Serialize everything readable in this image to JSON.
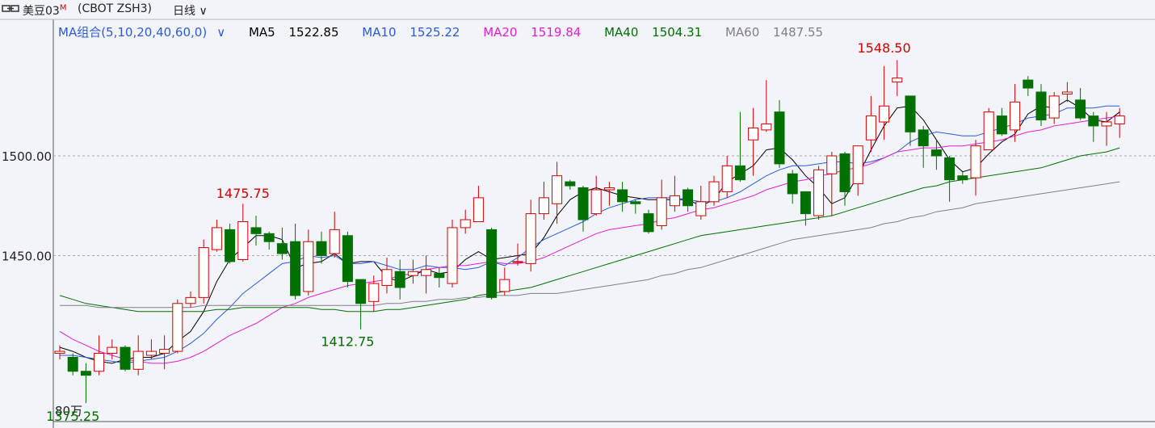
{
  "header": {
    "symbol": "美豆03",
    "symbol_sup": "M",
    "code": "(CBOT ZSH3)",
    "period": "日线"
  },
  "ma_legend": {
    "group": "MA组合(5,10,20,40,60,0)",
    "items": [
      {
        "label": "MA5",
        "value": "1522.85",
        "color": "#000000"
      },
      {
        "label": "MA10",
        "value": "1525.22",
        "color": "#2a5cd8"
      },
      {
        "label": "MA20",
        "value": "1519.84",
        "color": "#e020d0"
      },
      {
        "label": "MA40",
        "value": "1504.31",
        "color": "#007000"
      },
      {
        "label": "MA60",
        "value": "1487.55",
        "color": "#808080"
      }
    ]
  },
  "chart_data": {
    "type": "candlestick",
    "y_ticks": [
      {
        "value": 1500,
        "label": "1500.00"
      },
      {
        "value": 1450,
        "label": "1450.00"
      }
    ],
    "ylim": [
      1370,
      1560
    ],
    "annotations": [
      {
        "index": 14,
        "value": 1475.75,
        "label": "1475.75",
        "position": "above",
        "color": "#d00000"
      },
      {
        "index": 22,
        "value": 1412.75,
        "label": "1412.75",
        "position": "below",
        "color": "#007000"
      },
      {
        "index": 63,
        "value": 1548.5,
        "label": "1548.50",
        "position": "above",
        "color": "#d00000"
      },
      {
        "index": 1,
        "value": 1375.25,
        "label": "1375.25",
        "position": "below",
        "color": "#007000"
      }
    ],
    "bottom_label": "80万",
    "up_color": "#d00000",
    "down_color": "#007000",
    "candles": [
      [
        1401,
        1402,
        1405,
        1398
      ],
      [
        1399,
        1392,
        1401,
        1390
      ],
      [
        1392,
        1390,
        1396,
        1376
      ],
      [
        1392,
        1401,
        1410,
        1390
      ],
      [
        1401,
        1404,
        1408,
        1398
      ],
      [
        1404,
        1393,
        1405,
        1392
      ],
      [
        1393,
        1402,
        1410,
        1390
      ],
      [
        1400,
        1402,
        1408,
        1398
      ],
      [
        1401,
        1403,
        1410,
        1393
      ],
      [
        1402,
        1426,
        1428,
        1401
      ],
      [
        1426,
        1429,
        1432,
        1424
      ],
      [
        1429,
        1454,
        1458,
        1426
      ],
      [
        1453,
        1464,
        1468,
        1452
      ],
      [
        1463,
        1447,
        1466,
        1446
      ],
      [
        1448,
        1467,
        1476,
        1447
      ],
      [
        1464,
        1461,
        1470,
        1455
      ],
      [
        1461,
        1457,
        1462,
        1453
      ],
      [
        1456,
        1451,
        1464,
        1448
      ],
      [
        1457,
        1430,
        1466,
        1428
      ],
      [
        1432,
        1457,
        1463,
        1430
      ],
      [
        1457,
        1450,
        1462,
        1446
      ],
      [
        1451,
        1463,
        1472,
        1449
      ],
      [
        1460,
        1437,
        1462,
        1434
      ],
      [
        1438,
        1426,
        1438,
        1413
      ],
      [
        1427,
        1436,
        1440,
        1422
      ],
      [
        1435,
        1443,
        1449,
        1431
      ],
      [
        1442,
        1434,
        1448,
        1428
      ],
      [
        1440,
        1442,
        1448,
        1436
      ],
      [
        1440,
        1443,
        1450,
        1431
      ],
      [
        1441,
        1439,
        1444,
        1434
      ],
      [
        1436,
        1464,
        1468,
        1434
      ],
      [
        1464,
        1468,
        1473,
        1461
      ],
      [
        1467,
        1479,
        1485,
        1467
      ],
      [
        1463,
        1429,
        1464,
        1428
      ],
      [
        1432,
        1438,
        1444,
        1430
      ],
      [
        1447,
        1447,
        1456,
        1445
      ],
      [
        1446,
        1471,
        1478,
        1442
      ],
      [
        1471,
        1479,
        1487,
        1468
      ],
      [
        1476,
        1490,
        1497,
        1466
      ],
      [
        1487,
        1485,
        1488,
        1483
      ],
      [
        1484,
        1468,
        1485,
        1462
      ],
      [
        1471,
        1483,
        1490,
        1470
      ],
      [
        1483,
        1484,
        1487,
        1475
      ],
      [
        1483,
        1477,
        1487,
        1472
      ],
      [
        1477,
        1476,
        1478,
        1471
      ],
      [
        1471,
        1462,
        1473,
        1461
      ],
      [
        1465,
        1479,
        1488,
        1463
      ],
      [
        1475,
        1480,
        1490,
        1472
      ],
      [
        1483,
        1475,
        1484,
        1472
      ],
      [
        1470,
        1477,
        1485,
        1468
      ],
      [
        1477,
        1487,
        1490,
        1475
      ],
      [
        1482,
        1495,
        1500,
        1479
      ],
      [
        1495,
        1488,
        1522,
        1487
      ],
      [
        1508,
        1514,
        1524,
        1490
      ],
      [
        1513,
        1516,
        1538,
        1512
      ],
      [
        1522,
        1496,
        1528,
        1494
      ],
      [
        1491,
        1481,
        1493,
        1476
      ],
      [
        1482,
        1471,
        1482,
        1465
      ],
      [
        1470,
        1493,
        1495,
        1468
      ],
      [
        1491,
        1500,
        1502,
        1470
      ],
      [
        1501,
        1482,
        1502,
        1475
      ],
      [
        1486,
        1505,
        1505,
        1480
      ],
      [
        1508,
        1520,
        1530,
        1502
      ],
      [
        1517,
        1525,
        1545,
        1508
      ],
      [
        1537,
        1539,
        1548,
        1530
      ],
      [
        1530,
        1512,
        1530,
        1505
      ],
      [
        1513,
        1505,
        1515,
        1494
      ],
      [
        1503,
        1500,
        1508,
        1493
      ],
      [
        1499,
        1488,
        1500,
        1477
      ],
      [
        1490,
        1488,
        1492,
        1486
      ],
      [
        1489,
        1505,
        1508,
        1480
      ],
      [
        1503,
        1522,
        1524,
        1503
      ],
      [
        1520,
        1511,
        1524,
        1510
      ],
      [
        1513,
        1527,
        1536,
        1507
      ],
      [
        1538,
        1534,
        1540,
        1530
      ],
      [
        1532,
        1518,
        1536,
        1515
      ],
      [
        1519,
        1530,
        1532,
        1516
      ],
      [
        1531,
        1532,
        1537,
        1527
      ],
      [
        1528,
        1519,
        1534,
        1518
      ],
      [
        1520,
        1515,
        1522,
        1507
      ],
      [
        1515,
        1517,
        1522,
        1505
      ],
      [
        1516,
        1520,
        1524,
        1509
      ]
    ],
    "ma_lines": [
      {
        "name": "MA5",
        "color": "#000000",
        "values": [
          1404,
          1402,
          1399,
          1397,
          1396,
          1398,
          1399,
          1399,
          1401,
          1407,
          1412,
          1422,
          1437,
          1448,
          1454,
          1460,
          1460,
          1458,
          1444,
          1446,
          1447,
          1451,
          1446,
          1447,
          1447,
          1439,
          1437,
          1440,
          1443,
          1441,
          1442,
          1448,
          1452,
          1448,
          1449,
          1450,
          1451,
          1459,
          1470,
          1478,
          1482,
          1484,
          1482,
          1480,
          1479,
          1478,
          1478,
          1478,
          1478,
          1475,
          1478,
          1487,
          1491,
          1495,
          1503,
          1504,
          1498,
          1490,
          1484,
          1476,
          1479,
          1490,
          1503,
          1515,
          1524,
          1525,
          1518,
          1508,
          1498,
          1492,
          1494,
          1501,
          1507,
          1511,
          1521,
          1525,
          1524,
          1528,
          1524,
          1518,
          1517,
          1522
        ]
      },
      {
        "name": "MA10",
        "color": "#2a5cd8",
        "values": [
          1400,
          1400,
          1399,
          1398,
          1397,
          1396,
          1397,
          1398,
          1399,
          1402,
          1406,
          1411,
          1418,
          1424,
          1431,
          1436,
          1441,
          1446,
          1447,
          1450,
          1449,
          1450,
          1446,
          1446,
          1447,
          1445,
          1443,
          1443,
          1445,
          1444,
          1444,
          1443,
          1444,
          1447,
          1445,
          1449,
          1454,
          1458,
          1461,
          1464,
          1467,
          1471,
          1474,
          1476,
          1478,
          1479,
          1479,
          1479,
          1478,
          1477,
          1477,
          1479,
          1482,
          1486,
          1490,
          1493,
          1495,
          1495,
          1496,
          1497,
          1497,
          1496,
          1497,
          1499,
          1502,
          1507,
          1510,
          1512,
          1511,
          1510,
          1510,
          1512,
          1514,
          1516,
          1519,
          1520,
          1521,
          1524,
          1524,
          1524,
          1525,
          1525
        ]
      },
      {
        "name": "MA20",
        "color": "#e020d0",
        "values": [
          1412,
          1408,
          1405,
          1402,
          1400,
          1398,
          1397,
          1396,
          1396,
          1397,
          1399,
          1402,
          1406,
          1410,
          1413,
          1416,
          1420,
          1424,
          1426,
          1429,
          1431,
          1433,
          1435,
          1436,
          1437,
          1438,
          1440,
          1441,
          1443,
          1444,
          1445,
          1445,
          1446,
          1447,
          1446,
          1446,
          1447,
          1449,
          1452,
          1455,
          1458,
          1461,
          1463,
          1464,
          1465,
          1466,
          1468,
          1469,
          1471,
          1473,
          1474,
          1476,
          1478,
          1480,
          1483,
          1485,
          1487,
          1488,
          1490,
          1491,
          1493,
          1494,
          1496,
          1499,
          1502,
          1503,
          1504,
          1504,
          1505,
          1505,
          1506,
          1507,
          1508,
          1510,
          1512,
          1513,
          1515,
          1516,
          1517,
          1518,
          1519,
          1520
        ]
      },
      {
        "name": "MA40",
        "color": "#007000",
        "values": [
          1430,
          1428,
          1426,
          1425,
          1424,
          1423,
          1422,
          1422,
          1422,
          1422,
          1422,
          1422,
          1423,
          1423,
          1424,
          1424,
          1424,
          1424,
          1424,
          1424,
          1423,
          1423,
          1422,
          1422,
          1422,
          1423,
          1423,
          1424,
          1425,
          1426,
          1427,
          1428,
          1430,
          1431,
          1432,
          1433,
          1434,
          1436,
          1438,
          1440,
          1442,
          1444,
          1446,
          1448,
          1450,
          1452,
          1454,
          1456,
          1458,
          1460,
          1461,
          1462,
          1463,
          1464,
          1465,
          1466,
          1467,
          1468,
          1469,
          1470,
          1472,
          1474,
          1476,
          1478,
          1480,
          1482,
          1484,
          1485,
          1487,
          1488,
          1489,
          1490,
          1491,
          1492,
          1493,
          1494,
          1496,
          1498,
          1500,
          1501,
          1502,
          1504
        ]
      },
      {
        "name": "MA60",
        "color": "#808080",
        "values": [
          1425,
          1425,
          1425,
          1424,
          1424,
          1424,
          1424,
          1424,
          1424,
          1424,
          1424,
          1425,
          1425,
          1425,
          1425,
          1425,
          1425,
          1425,
          1425,
          1425,
          1425,
          1425,
          1425,
          1425,
          1425,
          1426,
          1426,
          1427,
          1427,
          1428,
          1428,
          1429,
          1429,
          1430,
          1430,
          1430,
          1431,
          1431,
          1431,
          1432,
          1433,
          1434,
          1435,
          1436,
          1437,
          1438,
          1440,
          1441,
          1443,
          1444,
          1446,
          1448,
          1450,
          1452,
          1454,
          1456,
          1458,
          1459,
          1460,
          1461,
          1462,
          1463,
          1464,
          1466,
          1467,
          1469,
          1470,
          1472,
          1473,
          1474,
          1476,
          1477,
          1478,
          1479,
          1480,
          1481,
          1482,
          1483,
          1484,
          1485,
          1486,
          1487
        ]
      }
    ]
  }
}
